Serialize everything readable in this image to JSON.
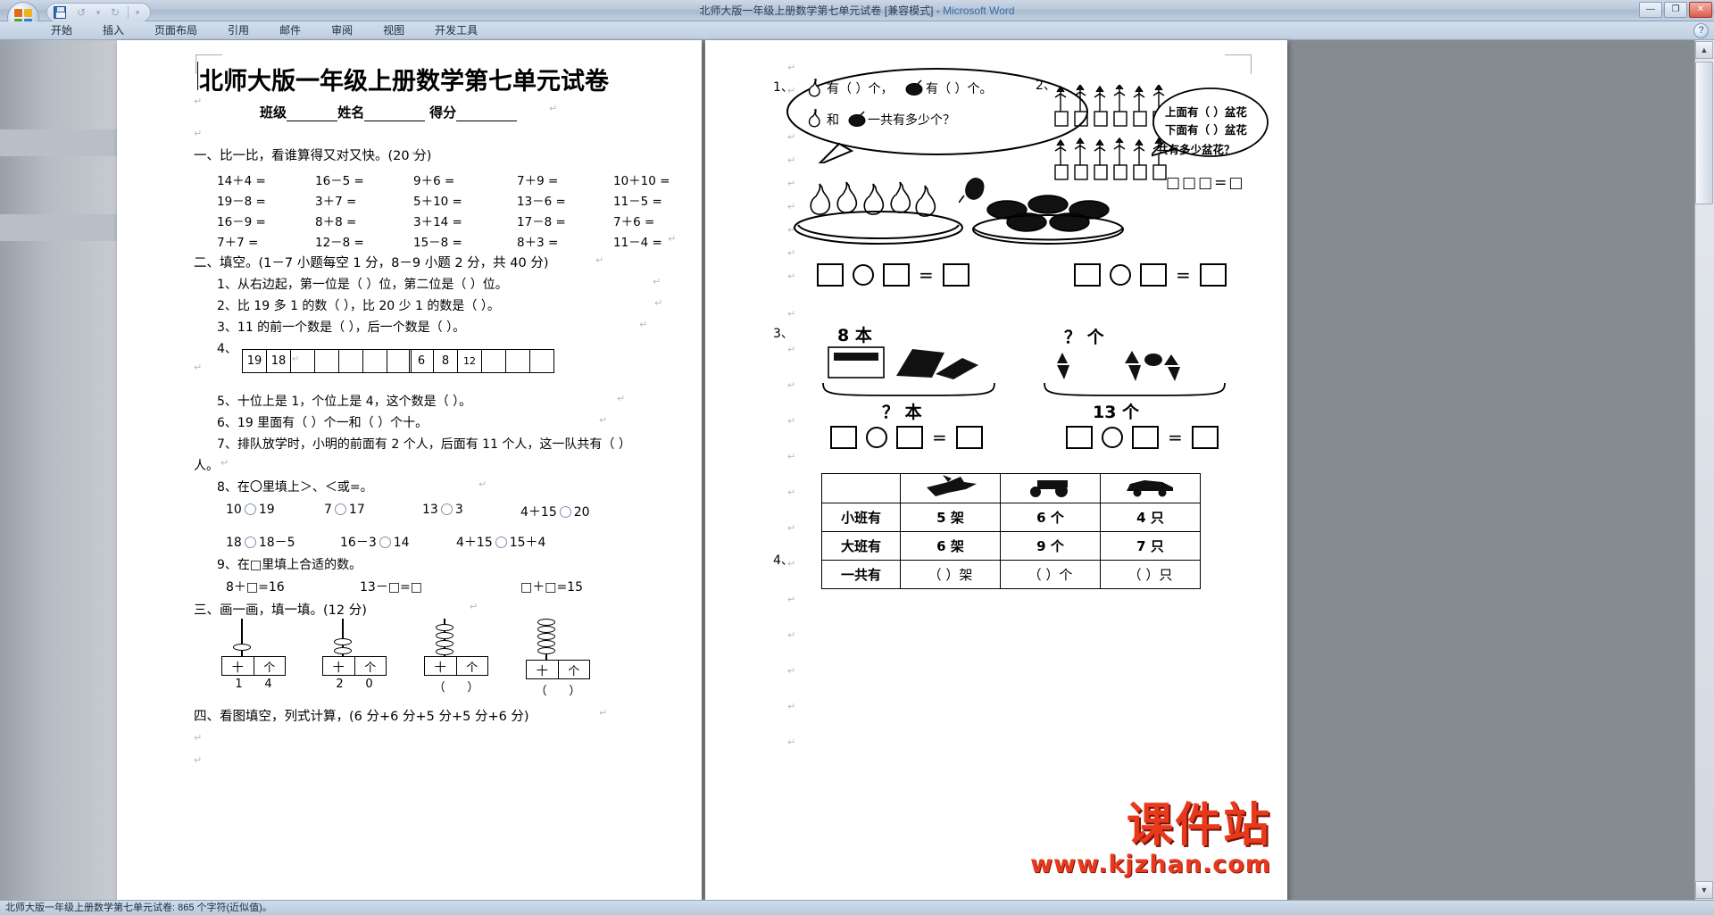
{
  "window": {
    "title": "北师大版一年级上册数学第七单元试卷 [兼容模式] - ",
    "app_name": "Microsoft Word",
    "minimize": "—",
    "maximize": "❐",
    "close": "✕",
    "help": "?"
  },
  "quick_access": {
    "office_button": "Office",
    "save": "save-icon",
    "undo": "↺",
    "undo_dropdown": "▾",
    "redo": "↻",
    "customize": "▾"
  },
  "ribbon": {
    "tabs": [
      {
        "label": "开始",
        "active": false
      },
      {
        "label": "插入",
        "active": false
      },
      {
        "label": "页面布局",
        "active": false
      },
      {
        "label": "引用",
        "active": false
      },
      {
        "label": "邮件",
        "active": false
      },
      {
        "label": "审阅",
        "active": false
      },
      {
        "label": "视图",
        "active": false
      },
      {
        "label": "开发工具",
        "active": false
      }
    ]
  },
  "scrollbar": {
    "up": "▲",
    "down": "▼"
  },
  "status_bar": {
    "text": "北师大版一年级上册数学第七单元试卷: 865 个字符(近似值)。"
  },
  "document": {
    "title": "北师大版一年级上册数学第七单元试卷",
    "info_row": {
      "class_label": "班级",
      "name_label": "姓名",
      "score_label": "得分"
    },
    "section1": {
      "heading": "一、比一比，看谁算得又对又快。(20 分)",
      "rows": [
        [
          "14＋4 =",
          "16－5 =",
          "9＋6 =",
          "7＋9 =",
          "10＋10 ="
        ],
        [
          "19－8 =",
          "3＋7 =",
          "5＋10 =",
          "13－6 =",
          "11－5 ="
        ],
        [
          "16－9 =",
          "8＋8 =",
          "3＋14 =",
          "17－8 =",
          "7＋6 ="
        ],
        [
          "7＋7 =",
          "12－8 =",
          "15－8 =",
          "8＋3 =",
          "11－4 ="
        ]
      ]
    },
    "section2": {
      "heading": "二、填空。(1－7 小题每空 1 分，8－9 小题 2 分，共 40 分)",
      "q1": "1、从右边起，第一位是（        ）位，第二位是（        ）位。",
      "q2": "2、比 19 多 1 的数（        ），比 20 少 1 的数是（        ）。",
      "q3": "3、11 的前一个数是（        ），后一个数是（        ）。",
      "q4_label": "4、",
      "q4_strip_a": [
        "19",
        "18",
        "",
        "",
        "",
        "",
        ""
      ],
      "q4_strip_b": [
        "6",
        "8",
        "12",
        "",
        "",
        ""
      ],
      "q5": "5、十位上是 1，个位上是 4，这个数是（        ）。",
      "q6": "6、19 里面有（        ）个一和（        ）个十。",
      "q7": "7、排队放学时，小明的前面有 2 个人，后面有 11 个人，这一队共有（        ）",
      "q7_cont": "人。",
      "q8_heading": "8、在〇里填上＞、＜或=。",
      "q8_row1": [
        {
          "left": "10",
          "right": "19"
        },
        {
          "left": "7",
          "right": "17"
        },
        {
          "left": "13",
          "right": "3"
        },
        {
          "left": "4＋15",
          "right": "20"
        }
      ],
      "q8_row2": [
        {
          "left": "18",
          "right": "18－5"
        },
        {
          "left": "16－3",
          "right": "14"
        },
        {
          "left": "4＋15",
          "right": "15＋4"
        }
      ],
      "q9_heading": "9、在□里填上合适的数。",
      "q9_items": [
        "8＋□=16",
        "13－□=□",
        "□＋□=15"
      ]
    },
    "section3": {
      "heading": "三、画一画，填一填。(12 分)",
      "abacus": [
        {
          "beads": 1,
          "left_label": "十",
          "right_label": "个",
          "caption_left": "1",
          "caption_right": "4"
        },
        {
          "beads": 2,
          "left_label": "十",
          "right_label": "个",
          "caption_left": "2",
          "caption_right": "0"
        },
        {
          "beads": 4,
          "left_label": "十",
          "right_label": "个",
          "caption_left": "（",
          "caption_right": "）"
        },
        {
          "beads": 6,
          "left_label": "十",
          "right_label": "个",
          "caption_left": "（",
          "caption_right": "）"
        }
      ]
    },
    "section4": {
      "heading": "四、看图填空，列式计算，(6 分+6 分+5 分+5 分+6 分)"
    },
    "right_page": {
      "p1_number": "1、",
      "p1_bubble_line1_a": "有（    ）个，",
      "p1_bubble_line1_b": "有（    ）个。",
      "p1_bubble_line2_a": "和",
      "p1_bubble_line2_b": "一共有多少个？",
      "p2_number": "2、",
      "p2_label1": "上面有（ ）盆花",
      "p2_label2": "下面有（ ）盆花",
      "p2_label3": "共有多少盆花？",
      "p2_mini_eq": "□□□=□",
      "p3_number": "3、",
      "p3_left_top": "8 本",
      "p3_left_bottom": "？ 本",
      "p3_right_top": "？ 个",
      "p3_right_bottom": "13 个",
      "p4_number": "4、",
      "table": {
        "headers": [
          "",
          "plane-icon",
          "tractor-icon",
          "car-icon"
        ],
        "rows": [
          {
            "label": "小班有",
            "cells": [
              "5 架",
              "6 个",
              "4 只"
            ]
          },
          {
            "label": "大班有",
            "cells": [
              "6 架",
              "9 个",
              "7 只"
            ]
          },
          {
            "label": "一共有",
            "cells": [
              "（    ）架",
              "（    ）个",
              "（    ）只"
            ]
          }
        ]
      }
    }
  },
  "watermark": {
    "brand": "课件站",
    "url": "www.kjzhan.com"
  },
  "colors": {
    "accent": "#3a6ea5",
    "watermark": "#e8391d",
    "circle": "#7f93ad"
  }
}
